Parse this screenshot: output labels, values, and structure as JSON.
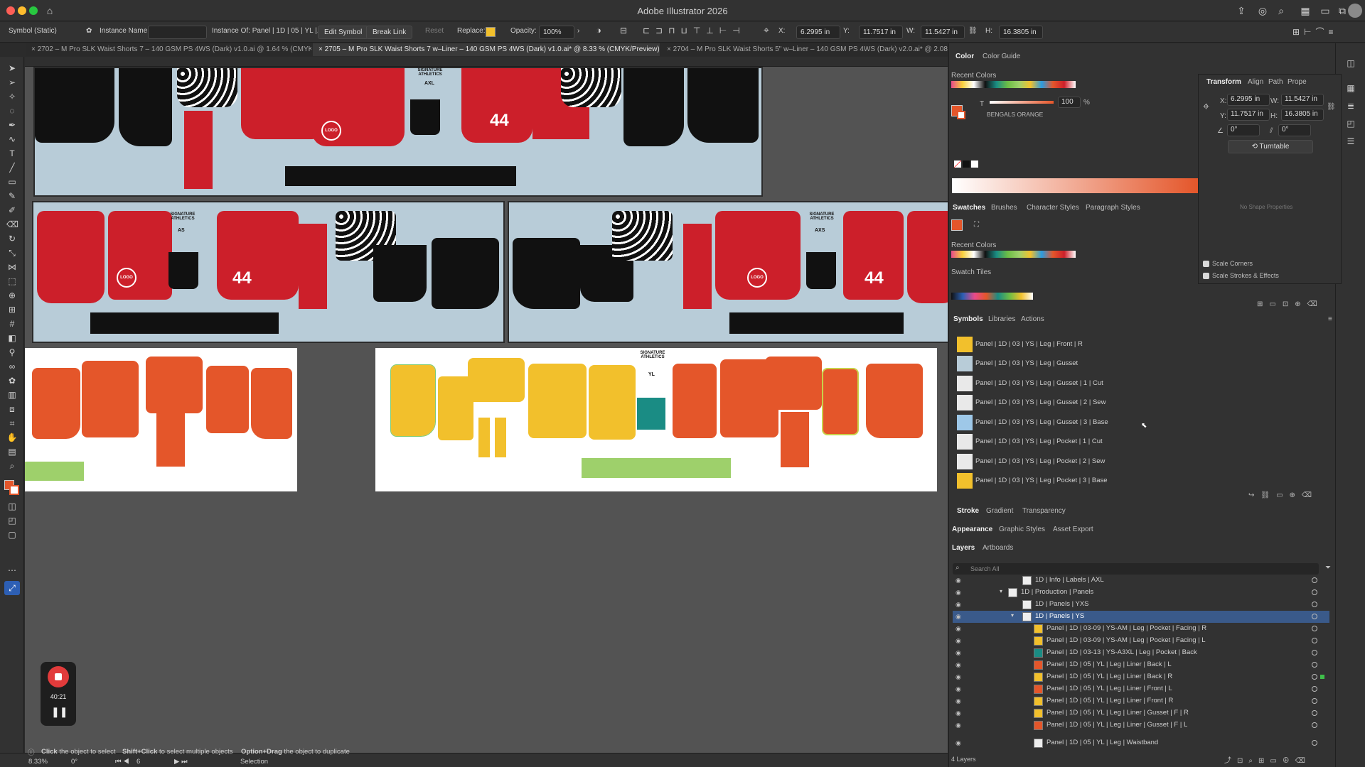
{
  "app": {
    "title": "Adobe Illustrator 2026"
  },
  "control_bar": {
    "selection_type": "Symbol (Static)",
    "instance_name_label": "Instance Name:",
    "instance_of": "Instance Of: Panel | 1D | 05 | YL |...",
    "edit_symbol": "Edit Symbol",
    "break_link": "Break Link",
    "reset": "Reset",
    "replace_label": "Replace:",
    "opacity_label": "Opacity:",
    "opacity_value": "100%",
    "x_label": "X:",
    "x_value": "6.2995 in",
    "y_label": "Y:",
    "y_value": "11.7517 in",
    "w_label": "W:",
    "w_value": "11.5427 in",
    "h_label": "H:",
    "h_value": "16.3805 in"
  },
  "tabs": [
    {
      "label": "2702 – M Pro SLK Waist Shorts 7 – 140 GSM PS 4WS (Dark) v1.0.ai @ 1.64 % (CMYK/Pr...",
      "active": false
    },
    {
      "label": "2705 – M Pro SLK Waist Shorts 7 w–Liner – 140 GSM PS 4WS (Dark) v1.0.ai* @ 8.33 % (CMYK/Preview)",
      "active": true
    },
    {
      "label": "2704 – M Pro SLK Waist Shorts 5\" w–Liner – 140 GSM PS 4WS (Dark) v2.0.ai* @ 2.08 ...",
      "active": false
    }
  ],
  "artwork": {
    "number": "44",
    "logo": "LOGO",
    "brand_line1": "SIGNATURE",
    "brand_line2": "ATHLETICS",
    "sizes": [
      "AXL",
      "AS",
      "AXS",
      "YL"
    ]
  },
  "color_panel": {
    "tabs": [
      "Color",
      "Color Guide"
    ],
    "recent_colors_label": "Recent Colors",
    "tint_value": "100",
    "tint_unit": "%",
    "swatch_name": "BENGALS ORANGE",
    "accent_color": "#e4562a"
  },
  "transform_panel": {
    "tabs": [
      "Transform",
      "Align",
      "Path",
      "Prope"
    ],
    "x_label": "X:",
    "x_value": "6.2995 in",
    "y_label": "Y:",
    "y_value": "11.7517 in",
    "w_label": "W:",
    "w_value": "11.5427 in",
    "h_label": "H:",
    "h_value": "16.3805 in",
    "angle_value": "0°",
    "shear_value": "0°",
    "turntable_label": "Turntable",
    "no_shape_label": "No Shape Properties",
    "scale_corners": "Scale Corners",
    "scale_strokes": "Scale Strokes & Effects"
  },
  "swatches_panel": {
    "tabs": [
      "Swatches",
      "Brushes",
      "Character Styles",
      "Paragraph Styles"
    ],
    "recent_colors_label": "Recent Colors",
    "swatch_tiles_label": "Swatch Tiles"
  },
  "symbols_panel": {
    "tabs": [
      "Symbols",
      "Libraries",
      "Actions"
    ],
    "items": [
      "Panel | 1D | 03 | YS | Leg | Front | R",
      "Panel | 1D | 03 | YS | Leg | Gusset",
      "Panel | 1D | 03 | YS | Leg | Gusset | 1 | Cut",
      "Panel | 1D | 03 | YS | Leg | Gusset | 2 | Sew",
      "Panel | 1D | 03 | YS | Leg | Gusset | 3 | Base",
      "Panel | 1D | 03 | YS | Leg | Pocket | 1 | Cut",
      "Panel | 1D | 03 | YS | Leg | Pocket | 2 | Sew",
      "Panel | 1D | 03 | YS | Leg | Pocket | 3 | Base"
    ]
  },
  "stroke_panel": {
    "tabs": [
      "Stroke",
      "Gradient",
      "Transparency"
    ]
  },
  "appearance_panel": {
    "tabs": [
      "Appearance",
      "Graphic Styles",
      "Asset Export"
    ]
  },
  "layers_panel": {
    "tabs": [
      "Layers",
      "Artboards"
    ],
    "search_placeholder": "Search All",
    "rows": [
      "1D | Info | Labels | AXL",
      "1D | Production | Panels",
      "1D | Panels | YXS",
      "1D | Panels | YS",
      "Panel | 1D | 03-09 | YS-AM | Leg | Pocket | Facing | R",
      "Panel | 1D | 03-09 | YS-AM | Leg | Pocket | Facing | L",
      "Panel | 1D | 03-13 | YS-A3XL | Leg | Pocket | Back",
      "Panel | 1D | 05 | YL | Leg | Liner | Back | L",
      "Panel | 1D | 05 | YL | Leg | Liner | Back | R",
      "Panel | 1D | 05 | YL | Leg | Liner | Front | L",
      "Panel | 1D | 05 | YL | Leg | Liner | Front | R",
      "Panel | 1D | 05 | YL | Leg | Liner | Gusset | F | R",
      "Panel | 1D | 05 | YL | Leg | Liner | Gusset | F | L",
      "Panel | 1D | 05 | YL | Leg | Waistband"
    ],
    "footer": "4 Layers"
  },
  "status_bar": {
    "hint1_b": "Click",
    "hint1": " the object to select",
    "hint2_b": "Shift+Click",
    "hint2": " to select multiple objects",
    "hint3_b": "Option+Drag",
    "hint3": " the object to duplicate",
    "zoom": "8.33%",
    "rotation": "0°",
    "artboard_num": "6",
    "tool": "Selection"
  },
  "recorder": {
    "time": "40:21"
  }
}
